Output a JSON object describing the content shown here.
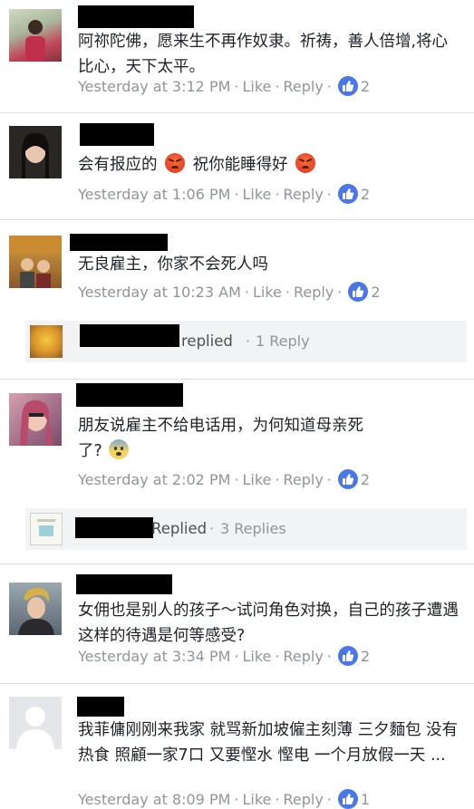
{
  "comments": [
    {
      "text": "阿祢陀佛，愿来生不再作奴隶。祈祷，善人倍增,将心比心，天下太平。",
      "time": "Yesterday at 3:12 PM",
      "like_label": "Like",
      "reply_label": "Reply",
      "reaction_count": "2"
    },
    {
      "text_before": "会有报应的",
      "text_middle": "祝你能睡得好",
      "time": "Yesterday at 1:06 PM",
      "like_label": "Like",
      "reply_label": "Reply",
      "reaction_count": "2"
    },
    {
      "text": "无良雇主，你家不会死人吗",
      "time": "Yesterday at 10:23 AM",
      "like_label": "Like",
      "reply_label": "Reply",
      "reaction_count": "2",
      "replies": {
        "action": "replied",
        "count_label": "1 Reply"
      }
    },
    {
      "text_line1": "朋友说雇主不给电话用，为何知道母亲死",
      "text_line2": "了?",
      "time": "Yesterday at 2:02 PM",
      "like_label": "Like",
      "reply_label": "Reply",
      "reaction_count": "2",
      "replies": {
        "action": "Replied",
        "count_label": "3 Replies"
      }
    },
    {
      "text": "女佣也是别人的孩子～试问角色对换，自己的孩子遭遇这样的待遇是何等感受?",
      "time": "Yesterday at 3:34 PM",
      "like_label": "Like",
      "reply_label": "Reply",
      "reaction_count": "2"
    },
    {
      "text": "我菲傭刚刚来我家 就骂新加坡僱主刻薄 三夕麵包 没有热食 照顧一家7口 又要慳水 慳电 一个月放假一天 ...",
      "time": "Yesterday at 8:09 PM",
      "like_label": "Like",
      "reply_label": "Reply",
      "reaction_count": "1"
    }
  ],
  "colors": {
    "meta_grey": "#90949c",
    "like_blue": "#4a76e8",
    "divider": "#dcdee3",
    "reply_bg": "#f2f3f5"
  },
  "icons": {
    "like": "thumbs-up-icon",
    "angry": "angry-face-emoji",
    "fear": "fearful-face-emoji",
    "default_avatar": "default-user-silhouette-icon"
  }
}
